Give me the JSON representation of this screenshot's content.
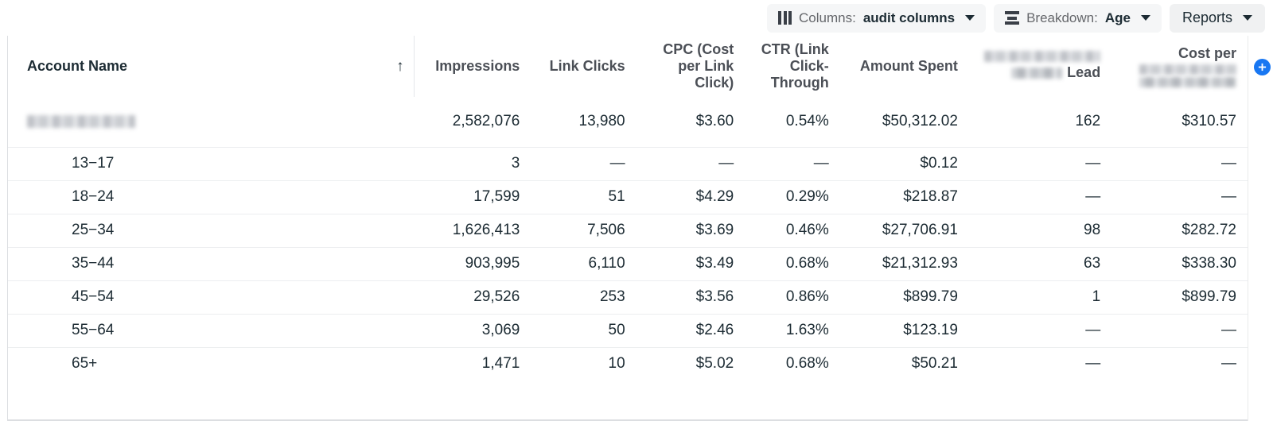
{
  "toolbar": {
    "columns": {
      "icon": "columns-icon",
      "label": "Columns:",
      "value": "audit columns",
      "caret": "chevron-down-icon"
    },
    "breakdown": {
      "icon": "breakdown-icon",
      "label": "Breakdown:",
      "value": "Age",
      "caret": "chevron-down-icon"
    },
    "reports": {
      "label": "Reports",
      "caret": "chevron-down-icon"
    }
  },
  "table": {
    "sort_indicator": "↑",
    "add_column_icon": "plus-circle-icon",
    "columns": [
      {
        "key": "account",
        "label": "Account Name",
        "align": "left",
        "sorted": true,
        "redacted": false
      },
      {
        "key": "impressions",
        "label": "Impressions",
        "align": "right",
        "redacted": false
      },
      {
        "key": "link_clicks",
        "label": "Link Clicks",
        "align": "right",
        "redacted": false
      },
      {
        "key": "cpc",
        "label": "CPC (Cost per Link Click)",
        "align": "right",
        "redacted": false
      },
      {
        "key": "ctr",
        "label": "CTR (Link Click-Through",
        "align": "right",
        "redacted": false
      },
      {
        "key": "amount_spent",
        "label": "Amount Spent",
        "align": "right",
        "redacted": false
      },
      {
        "key": "leads",
        "label": "Lead",
        "align": "right",
        "redacted": true
      },
      {
        "key": "cost_per_lead",
        "label": "Cost per",
        "align": "right",
        "redacted": true
      }
    ],
    "summary_row": {
      "account": "",
      "account_redacted": true,
      "impressions": "2,582,076",
      "link_clicks": "13,980",
      "cpc": "$3.60",
      "ctr": "0.54%",
      "amount_spent": "$50,312.02",
      "leads": "162",
      "cost_per_lead": "$310.57"
    },
    "rows": [
      {
        "account": "13−17",
        "impressions": "3",
        "link_clicks": "—",
        "cpc": "—",
        "ctr": "—",
        "amount_spent": "$0.12",
        "leads": "—",
        "cost_per_lead": "—"
      },
      {
        "account": "18−24",
        "impressions": "17,599",
        "link_clicks": "51",
        "cpc": "$4.29",
        "ctr": "0.29%",
        "amount_spent": "$218.87",
        "leads": "—",
        "cost_per_lead": "—"
      },
      {
        "account": "25−34",
        "impressions": "1,626,413",
        "link_clicks": "7,506",
        "cpc": "$3.69",
        "ctr": "0.46%",
        "amount_spent": "$27,706.91",
        "leads": "98",
        "cost_per_lead": "$282.72"
      },
      {
        "account": "35−44",
        "impressions": "903,995",
        "link_clicks": "6,110",
        "cpc": "$3.49",
        "ctr": "0.68%",
        "amount_spent": "$21,312.93",
        "leads": "63",
        "cost_per_lead": "$338.30"
      },
      {
        "account": "45−54",
        "impressions": "29,526",
        "link_clicks": "253",
        "cpc": "$3.56",
        "ctr": "0.86%",
        "amount_spent": "$899.79",
        "leads": "1",
        "cost_per_lead": "$899.79"
      },
      {
        "account": "55−64",
        "impressions": "3,069",
        "link_clicks": "50",
        "cpc": "$2.46",
        "ctr": "1.63%",
        "amount_spent": "$123.19",
        "leads": "—",
        "cost_per_lead": "—"
      },
      {
        "account": "65+",
        "impressions": "1,471",
        "link_clicks": "10",
        "cpc": "$5.02",
        "ctr": "0.68%",
        "amount_spent": "$50.21",
        "leads": "—",
        "cost_per_lead": "—"
      }
    ]
  },
  "colors": {
    "accent": "#1877f2",
    "header_text": "#4b4f56",
    "body_text": "#1c2b33",
    "chip_bg": "#f5f6f7",
    "rule": "#eceef0"
  }
}
